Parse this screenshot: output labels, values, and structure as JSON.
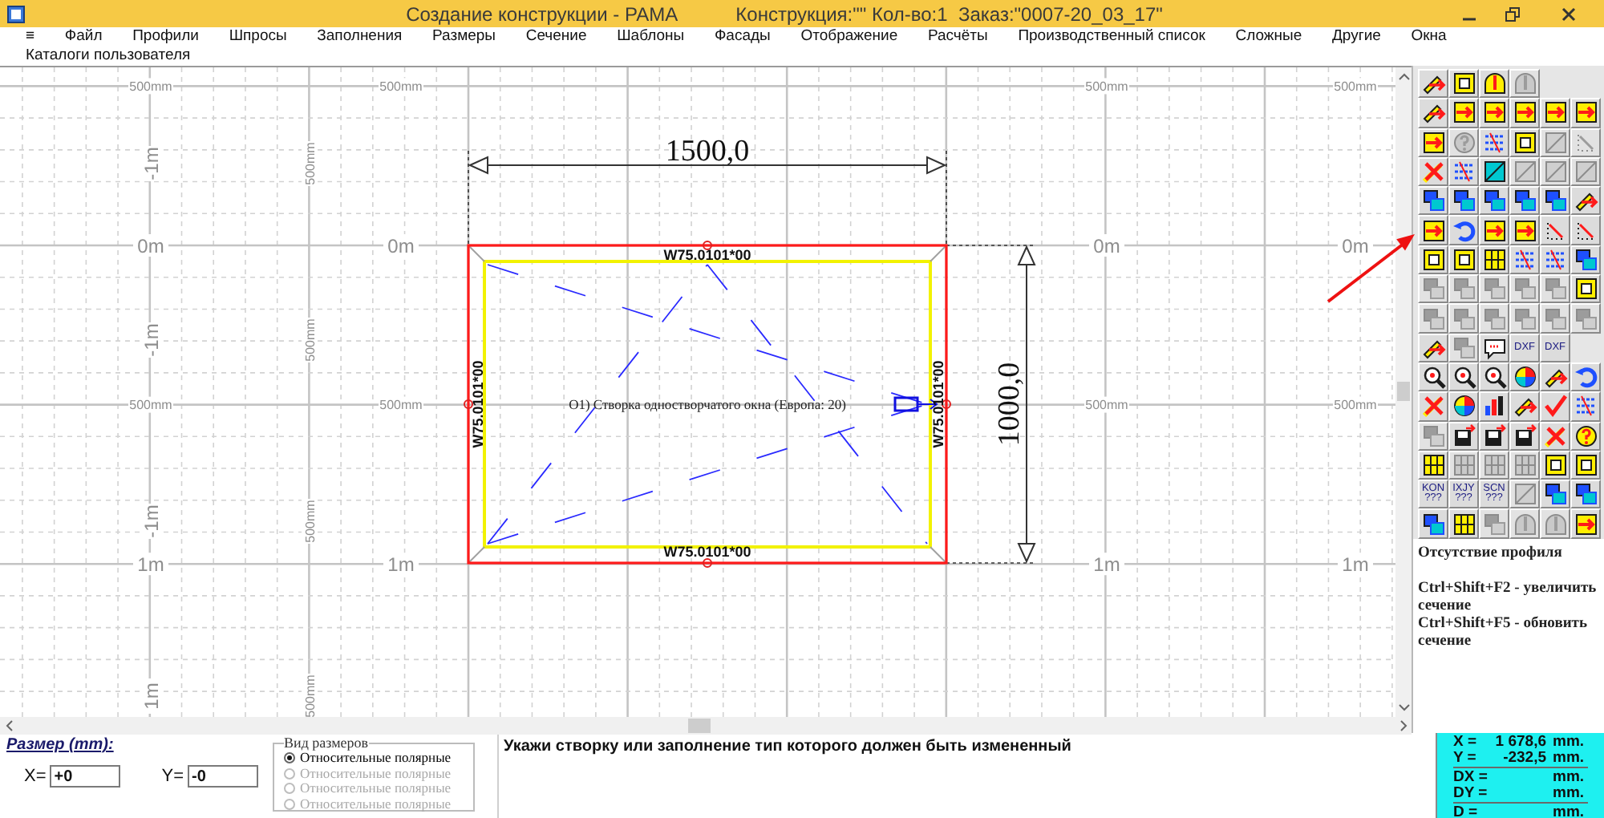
{
  "window": {
    "title": "Создание конструкции - РАМА",
    "info": "Конструкция:\"\" Кол-во:1  Заказ:\"0007-20_03_17\""
  },
  "menu": {
    "rows": [
      [
        "≡",
        "Файл",
        "Профили",
        "Шпросы",
        "Заполнения",
        "Размеры",
        "Сечение",
        "Шаблоны",
        "Фасады",
        "Отображение",
        "Расчёты",
        "Производственный список",
        "Сложные",
        "Другие",
        "Окна"
      ],
      [
        "Каталоги пользователя"
      ]
    ]
  },
  "canvas": {
    "grid_row_labels": [
      [
        "500mm",
        "500mm",
        "500mm",
        "500mm"
      ],
      [
        "0m",
        "0m",
        "0m",
        "0m"
      ],
      [
        "500mm",
        "500mm",
        "500mm",
        "500mm"
      ],
      [
        "1m",
        "1m",
        "1m",
        "1m"
      ]
    ],
    "grid_column_labels": [
      [
        "-1m",
        "-1m",
        "-1m",
        "1m"
      ],
      [
        "500mm",
        "500mm",
        "500mm",
        "500mm"
      ]
    ],
    "width_dimension": "1500,0",
    "height_dimension": "1000,0",
    "profile_labels": {
      "top": "W75.0101*00",
      "bottom": "W75.0101*00",
      "left": "W75.0101*00",
      "right": "W75.0101*00"
    },
    "sash_label": "O1) Створка одностворчатого окна (Европа: 20)"
  },
  "toolbar": {
    "rows": [
      [
        {
          "kind": "arrows",
          "disabled": false
        },
        {
          "kind": "frame",
          "disabled": false
        },
        {
          "kind": "arch",
          "disabled": false
        },
        {
          "kind": "arch",
          "disabled": true
        }
      ],
      [
        {
          "kind": "arrows",
          "disabled": false
        },
        {
          "kind": "frame-arrow",
          "disabled": false
        },
        {
          "kind": "frame-arrow",
          "disabled": false
        },
        {
          "kind": "frame-arrow",
          "disabled": false
        },
        {
          "kind": "frame-arrow",
          "disabled": false
        },
        {
          "kind": "frame-arrow",
          "disabled": false
        }
      ],
      [
        {
          "kind": "frame-arrow",
          "disabled": false
        },
        {
          "kind": "question",
          "disabled": true
        },
        {
          "kind": "numbers",
          "disabled": false
        },
        {
          "kind": "frame",
          "disabled": false
        },
        {
          "kind": "square",
          "disabled": true
        },
        {
          "kind": "dots",
          "disabled": true
        }
      ],
      [
        {
          "kind": "cross",
          "disabled": false
        },
        {
          "kind": "numbers",
          "disabled": false
        },
        {
          "kind": "square",
          "disabled": false
        },
        {
          "kind": "square",
          "disabled": true
        },
        {
          "kind": "square",
          "disabled": true
        },
        {
          "kind": "square",
          "disabled": true
        }
      ],
      [
        {
          "kind": "blocks",
          "disabled": false
        },
        {
          "kind": "blocks",
          "disabled": false
        },
        {
          "kind": "blocks",
          "disabled": false
        },
        {
          "kind": "blocks",
          "disabled": false
        },
        {
          "kind": "blocks",
          "disabled": false
        },
        {
          "kind": "arrows",
          "disabled": false
        }
      ],
      [
        {
          "kind": "frame-arrow",
          "disabled": false
        },
        {
          "kind": "undo",
          "disabled": false
        },
        {
          "kind": "frame-arrow",
          "disabled": false
        },
        {
          "kind": "frame-arrow",
          "disabled": false
        },
        {
          "kind": "dots",
          "disabled": false
        },
        {
          "kind": "dots",
          "disabled": false
        }
      ],
      [
        {
          "kind": "frame",
          "disabled": false
        },
        {
          "kind": "frame",
          "disabled": false
        },
        {
          "kind": "grid",
          "disabled": false
        },
        {
          "kind": "numbers",
          "disabled": false
        },
        {
          "kind": "numbers",
          "disabled": false
        },
        {
          "kind": "blocks",
          "disabled": false
        }
      ],
      [
        {
          "kind": "blocks",
          "disabled": true
        },
        {
          "kind": "blocks",
          "disabled": true
        },
        {
          "kind": "blocks",
          "disabled": true
        },
        {
          "kind": "blocks",
          "disabled": true
        },
        {
          "kind": "blocks",
          "disabled": true
        },
        {
          "kind": "frame",
          "disabled": false
        }
      ],
      [
        {
          "kind": "blocks",
          "disabled": true
        },
        {
          "kind": "blocks",
          "disabled": true
        },
        {
          "kind": "blocks",
          "disabled": true
        },
        {
          "kind": "blocks",
          "disabled": true
        },
        {
          "kind": "blocks",
          "disabled": true
        },
        {
          "kind": "blocks",
          "disabled": true
        }
      ],
      [
        {
          "kind": "arrows",
          "disabled": false
        },
        {
          "kind": "blocks",
          "disabled": true
        },
        {
          "kind": "bubble",
          "disabled": false
        },
        {
          "kind": "text",
          "label": "DXF",
          "disabled": false
        },
        {
          "kind": "text",
          "label": "DXF",
          "disabled": false
        }
      ],
      [
        {
          "kind": "zoom",
          "disabled": false
        },
        {
          "kind": "zoom",
          "disabled": false
        },
        {
          "kind": "zoom",
          "disabled": false
        },
        {
          "kind": "wheel",
          "disabled": false
        },
        {
          "kind": "arrows",
          "disabled": false
        },
        {
          "kind": "undo",
          "disabled": false
        }
      ],
      [
        {
          "kind": "cross",
          "disabled": false
        },
        {
          "kind": "wheel",
          "disabled": false
        },
        {
          "kind": "bars",
          "disabled": false
        },
        {
          "kind": "arrows",
          "disabled": false
        },
        {
          "kind": "check",
          "disabled": false
        },
        {
          "kind": "numbers",
          "disabled": false
        }
      ],
      [
        {
          "kind": "blocks",
          "disabled": true
        },
        {
          "kind": "floppy",
          "disabled": false
        },
        {
          "kind": "floppy",
          "disabled": false
        },
        {
          "kind": "floppy",
          "disabled": false
        },
        {
          "kind": "cross",
          "disabled": false
        },
        {
          "kind": "question",
          "disabled": false
        }
      ],
      [
        {
          "kind": "grid",
          "disabled": false
        },
        {
          "kind": "grid",
          "disabled": true
        },
        {
          "kind": "grid",
          "disabled": true
        },
        {
          "kind": "grid",
          "disabled": true
        },
        {
          "kind": "frame",
          "disabled": false
        },
        {
          "kind": "frame",
          "disabled": false
        }
      ],
      [
        {
          "kind": "text",
          "label": "KON ???",
          "disabled": false
        },
        {
          "kind": "text",
          "label": "IXJY ???",
          "disabled": false
        },
        {
          "kind": "text",
          "label": "SCN ???",
          "disabled": false
        },
        {
          "kind": "square",
          "disabled": true
        },
        {
          "kind": "blocks",
          "disabled": false
        },
        {
          "kind": "blocks",
          "disabled": false
        }
      ],
      [
        {
          "kind": "blocks",
          "disabled": false
        },
        {
          "kind": "grid",
          "disabled": false
        },
        {
          "kind": "blocks",
          "disabled": true
        },
        {
          "kind": "arch",
          "disabled": true
        },
        {
          "kind": "arch",
          "disabled": true
        },
        {
          "kind": "frame-arrow",
          "disabled": false
        }
      ]
    ]
  },
  "hints": {
    "status": "Отсутствие профиля",
    "lines": [
      "Ctrl+Shift+F2 - увеличить сечение",
      "Ctrl+Shift+F5 - обновить сечение"
    ]
  },
  "size": {
    "title": "Размер (mm):",
    "fields": [
      {
        "label": "X=",
        "value": "+0"
      },
      {
        "label": "Y=",
        "value": "-0"
      }
    ]
  },
  "dimension_view": {
    "title": "Вид размеров",
    "options": [
      {
        "label": "Относительные полярные",
        "selected": true,
        "disabled": false
      },
      {
        "label": "Относительные полярные",
        "selected": false,
        "disabled": true
      },
      {
        "label": "Относительные полярные",
        "selected": false,
        "disabled": true
      },
      {
        "label": "Относительные полярные",
        "selected": false,
        "disabled": true
      }
    ]
  },
  "message": "Укажи створку или заполнение тип которого должен быть измененный",
  "coordinates": {
    "groups": [
      [
        {
          "label": "X =",
          "value": "1 678,6",
          "unit": "mm."
        },
        {
          "label": "Y =",
          "value": "-232,5",
          "unit": "mm."
        }
      ],
      [
        {
          "label": "DX =",
          "unit": "mm."
        },
        {
          "label": "DY =",
          "unit": "mm."
        }
      ],
      [
        {
          "label": "D =",
          "unit": "mm."
        }
      ]
    ]
  }
}
